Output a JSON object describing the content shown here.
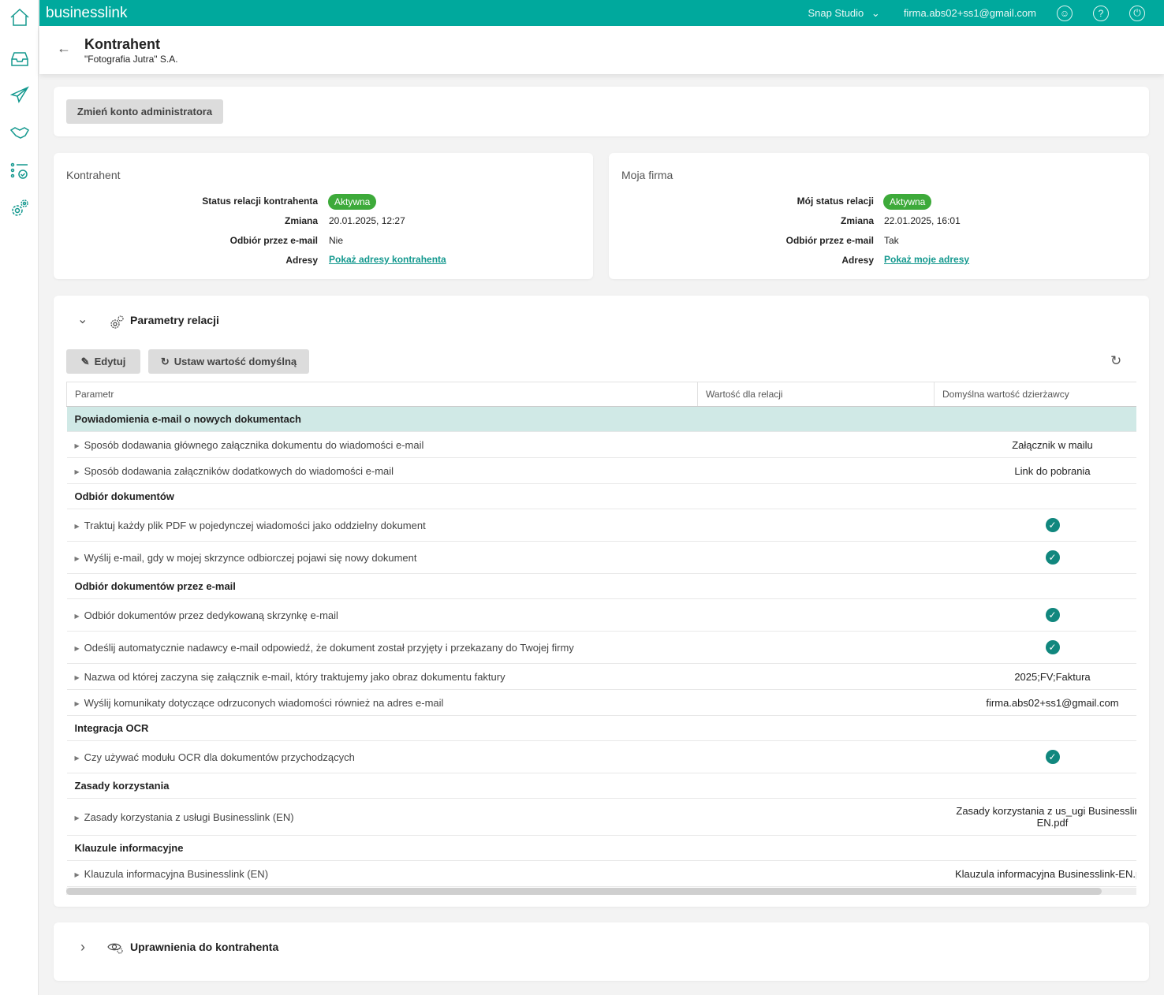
{
  "topbar": {
    "brand": "businesslink",
    "company": "Snap Studio",
    "email": "firma.abs02+ss1@gmail.com"
  },
  "header": {
    "title": "Kontrahent",
    "subtitle": "\"Fotografia Jutra\" S.A."
  },
  "admin_button": "Zmień konto administratora",
  "kontrahent": {
    "title": "Kontrahent",
    "rows": [
      {
        "label": "Status relacji kontrahenta",
        "value": "Aktywna"
      },
      {
        "label": "Zmiana",
        "value": "20.01.2025, 12:27"
      },
      {
        "label": "Odbiór przez e-mail",
        "value": "Nie"
      },
      {
        "label": "Adresy",
        "value": "Pokaż adresy kontrahenta"
      }
    ]
  },
  "moja_firma": {
    "title": "Moja firma",
    "rows": [
      {
        "label": "Mój status relacji",
        "value": "Aktywna"
      },
      {
        "label": "Zmiana",
        "value": "22.01.2025, 16:01"
      },
      {
        "label": "Odbiór przez e-mail",
        "value": "Tak"
      },
      {
        "label": "Adresy",
        "value": "Pokaż moje adresy"
      }
    ]
  },
  "params": {
    "title": "Parametry relacji",
    "edit": "Edytuj",
    "set_default": "Ustaw wartość domyślną",
    "columns": [
      "Parametr",
      "Wartość dla relacji",
      "Domyślna wartość dzierżawcy"
    ],
    "rows": [
      {
        "type": "group",
        "label": "Powiadomienia e-mail o nowych dokumentach"
      },
      {
        "label": "Sposób dodawania głównego załącznika dokumentu do wiadomości e-mail",
        "relation": "",
        "default": "Załącznik w mailu"
      },
      {
        "label": "Sposób dodawania załączników dodatkowych do wiadomości e-mail",
        "relation": "",
        "default": "Link do pobrania"
      },
      {
        "type": "group",
        "label": "Odbiór dokumentów"
      },
      {
        "label": "Traktuj każdy plik PDF w pojedynczej wiadomości jako oddzielny dokument",
        "relation": "",
        "default": "check"
      },
      {
        "label": "Wyślij e-mail, gdy w mojej skrzynce odbiorczej pojawi się nowy dokument",
        "relation": "",
        "default": "check"
      },
      {
        "type": "group",
        "label": "Odbiór dokumentów przez e-mail"
      },
      {
        "label": "Odbiór dokumentów przez dedykowaną skrzynkę e-mail",
        "relation": "",
        "default": "check"
      },
      {
        "label": "Odeślij automatycznie nadawcy e-mail odpowiedź, że dokument został przyjęty i przekazany do Twojej firmy",
        "relation": "",
        "default": "check"
      },
      {
        "label": "Nazwa od której zaczyna się załącznik e-mail, który traktujemy jako obraz dokumentu faktury",
        "relation": "",
        "default": "2025;FV;Faktura"
      },
      {
        "label": "Wyślij komunikaty dotyczące odrzuconych wiadomości również na adres e-mail",
        "relation": "",
        "default": "firma.abs02+ss1@gmail.com"
      },
      {
        "type": "group",
        "label": "Integracja OCR"
      },
      {
        "label": "Czy używać modułu OCR dla dokumentów przychodzących",
        "relation": "",
        "default": "check"
      },
      {
        "type": "group",
        "label": "Zasady korzystania"
      },
      {
        "label": "Zasady korzystania z usługi Businesslink (EN)",
        "relation": "",
        "default": "Zasady korzystania z us_ugi Businesslink-EN.pdf"
      },
      {
        "type": "group",
        "label": "Klauzule informacyjne"
      },
      {
        "label": "Klauzula informacyjna Businesslink (EN)",
        "relation": "",
        "default": "Klauzula informacyjna Businesslink-EN.pdf"
      }
    ]
  },
  "permissions": {
    "title": "Uprawnienia do kontrahenta"
  },
  "colors": {
    "accent": "#00a99d",
    "active": "#3daa3a",
    "group_bg": "#d0e9e6"
  }
}
